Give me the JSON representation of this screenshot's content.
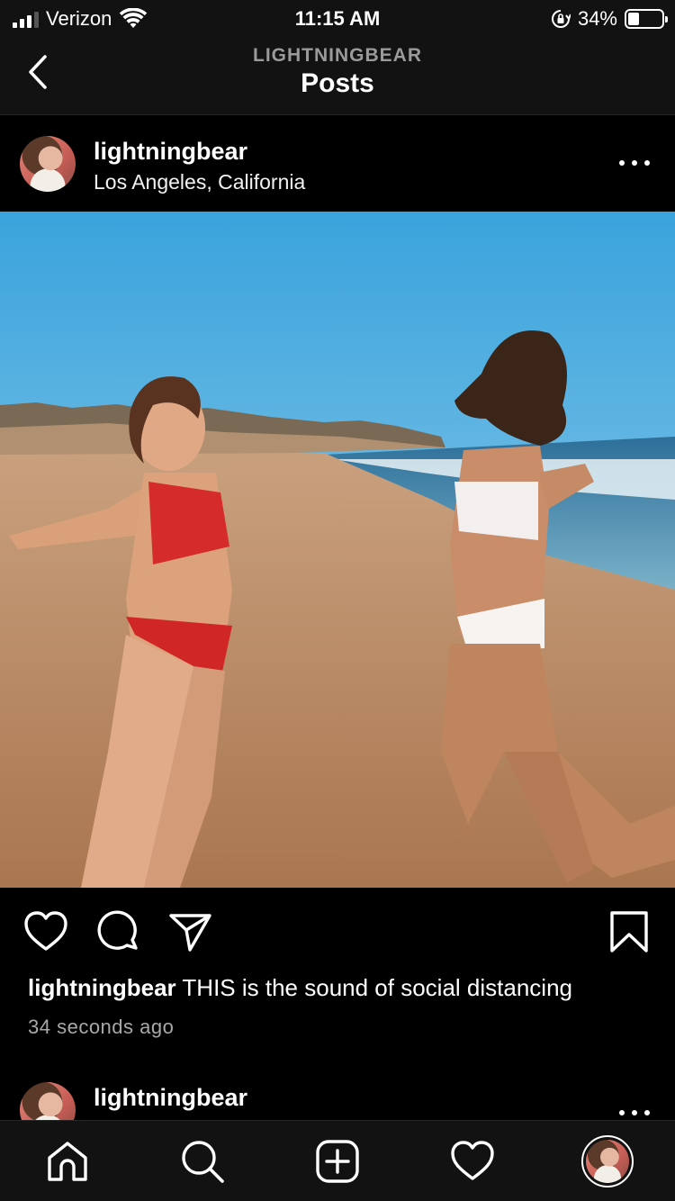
{
  "status_bar": {
    "carrier": "Verizon",
    "time": "11:15 AM",
    "battery_percent_label": "34%",
    "battery_level": 0.34,
    "signal_bars": 3,
    "icons": [
      "wifi-icon",
      "rotation-lock-icon",
      "battery-icon"
    ]
  },
  "header": {
    "account_name": "LIGHTNINGBEAR",
    "title": "Posts",
    "back_icon": "chevron-left-icon"
  },
  "post": {
    "username": "lightningbear",
    "location": "Los Angeles, California",
    "more_icon": "more-horizontal-icon",
    "photo": "beach-photo",
    "actions": {
      "like_icon": "heart-icon",
      "comment_icon": "comment-icon",
      "share_icon": "send-icon",
      "save_icon": "bookmark-icon"
    },
    "caption_username": "lightningbear",
    "caption_text": " THIS is the sound of social distancing",
    "time_ago": "34 seconds ago"
  },
  "next_post": {
    "username": "lightningbear"
  },
  "tab_bar": {
    "items": [
      "home-icon",
      "search-icon",
      "add-post-icon",
      "activity-heart-icon",
      "profile-avatar"
    ]
  },
  "colors": {
    "background": "#000000",
    "bar_background": "#121212",
    "secondary_text": "#a8a8a8"
  }
}
